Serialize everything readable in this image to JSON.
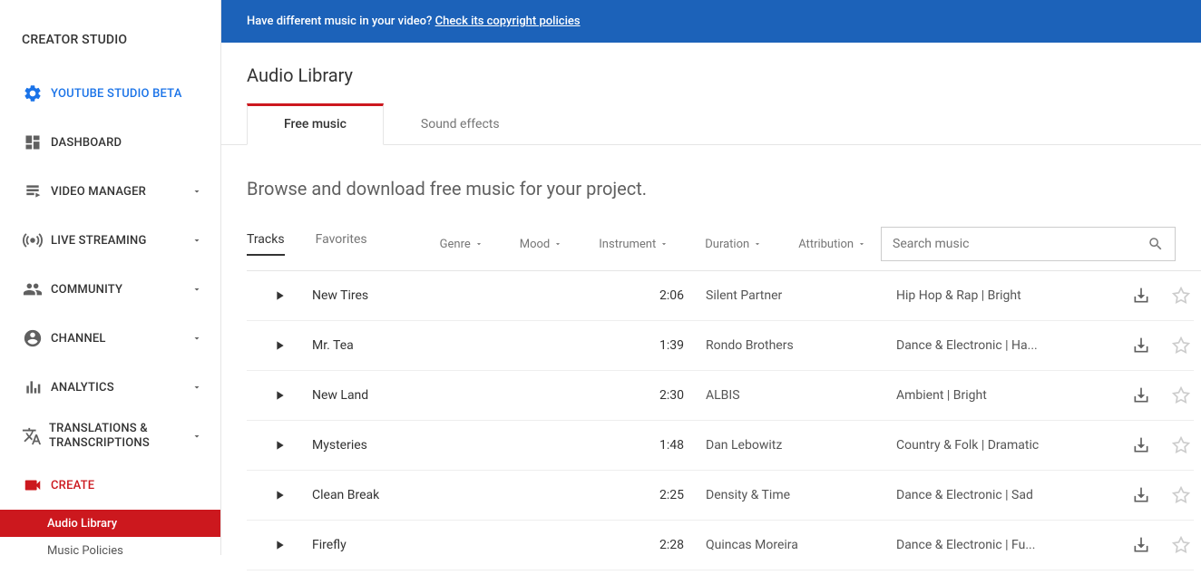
{
  "sidebar": {
    "title": "CREATOR STUDIO",
    "items": [
      {
        "label": "YOUTUBE STUDIO BETA",
        "icon": "gear"
      },
      {
        "label": "DASHBOARD",
        "icon": "dashboard"
      },
      {
        "label": "VIDEO MANAGER",
        "icon": "folder",
        "chevron": true
      },
      {
        "label": "LIVE STREAMING",
        "icon": "live",
        "chevron": true
      },
      {
        "label": "COMMUNITY",
        "icon": "community",
        "chevron": true
      },
      {
        "label": "CHANNEL",
        "icon": "account",
        "chevron": true
      },
      {
        "label": "ANALYTICS",
        "icon": "analytics",
        "chevron": true
      },
      {
        "label": "TRANSLATIONS & TRANSCRIPTIONS",
        "icon": "translate",
        "chevron": true
      },
      {
        "label": "CREATE",
        "icon": "camera"
      }
    ],
    "subitems": [
      {
        "label": "Audio Library",
        "active": true
      },
      {
        "label": "Music Policies",
        "active": false
      }
    ]
  },
  "banner": {
    "text": "Have different music in your video? ",
    "link": "Check its copyright policies"
  },
  "page": {
    "title": "Audio Library",
    "tabs": [
      {
        "label": "Free music",
        "active": true
      },
      {
        "label": "Sound effects",
        "active": false
      }
    ],
    "subtitle": "Browse and download free music for your project.",
    "subtabs": [
      {
        "label": "Tracks",
        "active": true
      },
      {
        "label": "Favorites",
        "active": false
      }
    ],
    "filters": [
      "Genre",
      "Mood",
      "Instrument",
      "Duration",
      "Attribution"
    ],
    "search_placeholder": "Search music"
  },
  "tracks": [
    {
      "title": "New Tires",
      "duration": "2:06",
      "artist": "Silent Partner",
      "genre": "Hip Hop & Rap | Bright"
    },
    {
      "title": "Mr. Tea",
      "duration": "1:39",
      "artist": "Rondo Brothers",
      "genre": "Dance & Electronic | Ha..."
    },
    {
      "title": "New Land",
      "duration": "2:30",
      "artist": "ALBIS",
      "genre": "Ambient | Bright"
    },
    {
      "title": "Mysteries",
      "duration": "1:48",
      "artist": "Dan Lebowitz",
      "genre": "Country & Folk | Dramatic"
    },
    {
      "title": "Clean Break",
      "duration": "2:25",
      "artist": "Density & Time",
      "genre": "Dance & Electronic | Sad"
    },
    {
      "title": "Firefly",
      "duration": "2:28",
      "artist": "Quincas Moreira",
      "genre": "Dance & Electronic | Fu..."
    }
  ]
}
